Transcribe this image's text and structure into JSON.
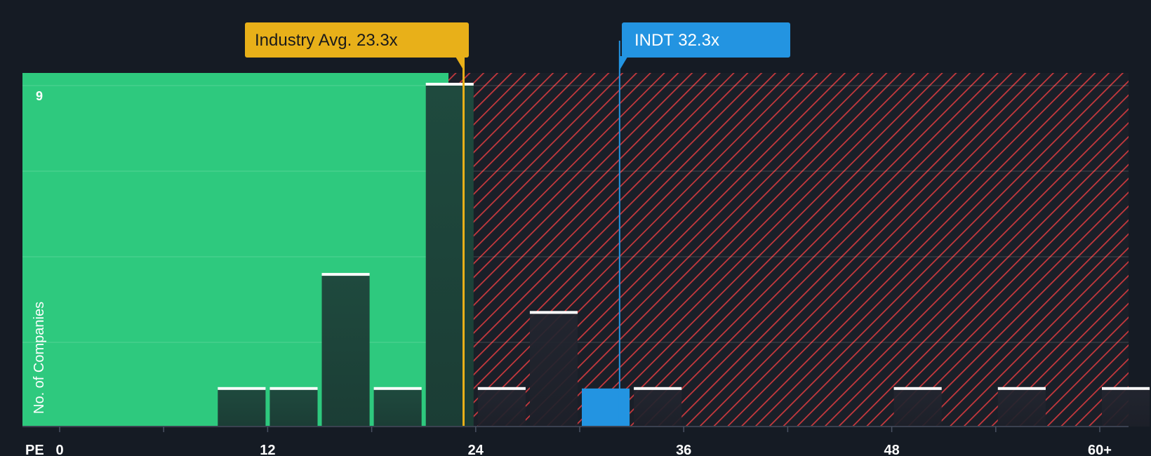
{
  "chart_data": {
    "type": "bar",
    "title": "",
    "xlabel": "PE",
    "ylabel": "No. of Companies",
    "x_ticks": [
      "0",
      "12",
      "24",
      "36",
      "48",
      "60+"
    ],
    "xlim": [
      -2,
      61
    ],
    "ylim": [
      0,
      9.4
    ],
    "y_ticks_labeled": [
      "9"
    ],
    "grid": true,
    "bin_width": 3,
    "bins": [
      {
        "start": 9,
        "value": 1
      },
      {
        "start": 12,
        "value": 1
      },
      {
        "start": 15,
        "value": 4
      },
      {
        "start": 18,
        "value": 1
      },
      {
        "start": 21,
        "value": 9
      },
      {
        "start": 24,
        "value": 1
      },
      {
        "start": 27,
        "value": 3
      },
      {
        "start": 30,
        "value": 1,
        "highlight": true
      },
      {
        "start": 33,
        "value": 1
      },
      {
        "start": 48,
        "value": 1
      },
      {
        "start": 54,
        "value": 1
      },
      {
        "start": 60,
        "value": 1
      }
    ],
    "markers": {
      "industry": {
        "label": "Industry Avg. 23.3x",
        "value": 23.3
      },
      "company": {
        "label": "INDT 32.3x",
        "value": 32.3
      }
    },
    "colors": {
      "background": "#151b24",
      "good_zone": "#2ec97e",
      "bad_stripe": "#c8393e",
      "bar_dark": "#1f4a3e",
      "bar_dark_right": "#222630",
      "highlight_bar": "#2394e1",
      "industry_marker": "#e8b019",
      "company_marker": "#2394e1",
      "bar_cap": "#ffffff",
      "text": "#ffffff"
    }
  }
}
